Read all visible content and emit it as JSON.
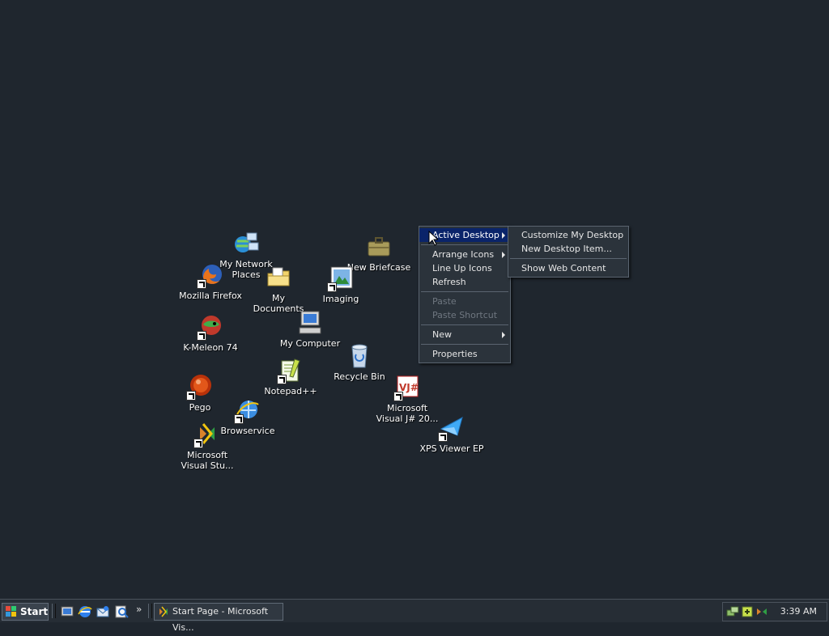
{
  "desktop": {
    "icons": [
      {
        "label": "My Network Places"
      },
      {
        "label": "New Briefcase"
      },
      {
        "label": "Mozilla Firefox"
      },
      {
        "label": "My Documents"
      },
      {
        "label": "Imaging"
      },
      {
        "label": "K-Meleon 74"
      },
      {
        "label": "My Computer"
      },
      {
        "label": "Recycle Bin"
      },
      {
        "label": "Notepad++"
      },
      {
        "label": "Pego"
      },
      {
        "label": "Microsoft Visual J# 20..."
      },
      {
        "label": "Browservice"
      },
      {
        "label": "XPS Viewer EP"
      },
      {
        "label": "Microsoft Visual Stu..."
      }
    ]
  },
  "context_menu": {
    "items": [
      {
        "label": "Active Desktop"
      },
      {
        "label": "Arrange Icons"
      },
      {
        "label": "Line Up Icons"
      },
      {
        "label": "Refresh"
      },
      {
        "label": "Paste"
      },
      {
        "label": "Paste Shortcut"
      },
      {
        "label": "New"
      },
      {
        "label": "Properties"
      }
    ],
    "submenu": [
      {
        "label": "Customize My Desktop"
      },
      {
        "label": "New Desktop Item..."
      },
      {
        "label": "Show Web Content"
      }
    ]
  },
  "taskbar": {
    "start_label": "Start",
    "task_label": "Start Page - Microsoft Vis...",
    "chevron": "»",
    "clock": "3:39 AM"
  },
  "colors": {
    "desktop": "#1f262e",
    "menu_bg": "#2b333b",
    "highlight": "#0a246a"
  }
}
